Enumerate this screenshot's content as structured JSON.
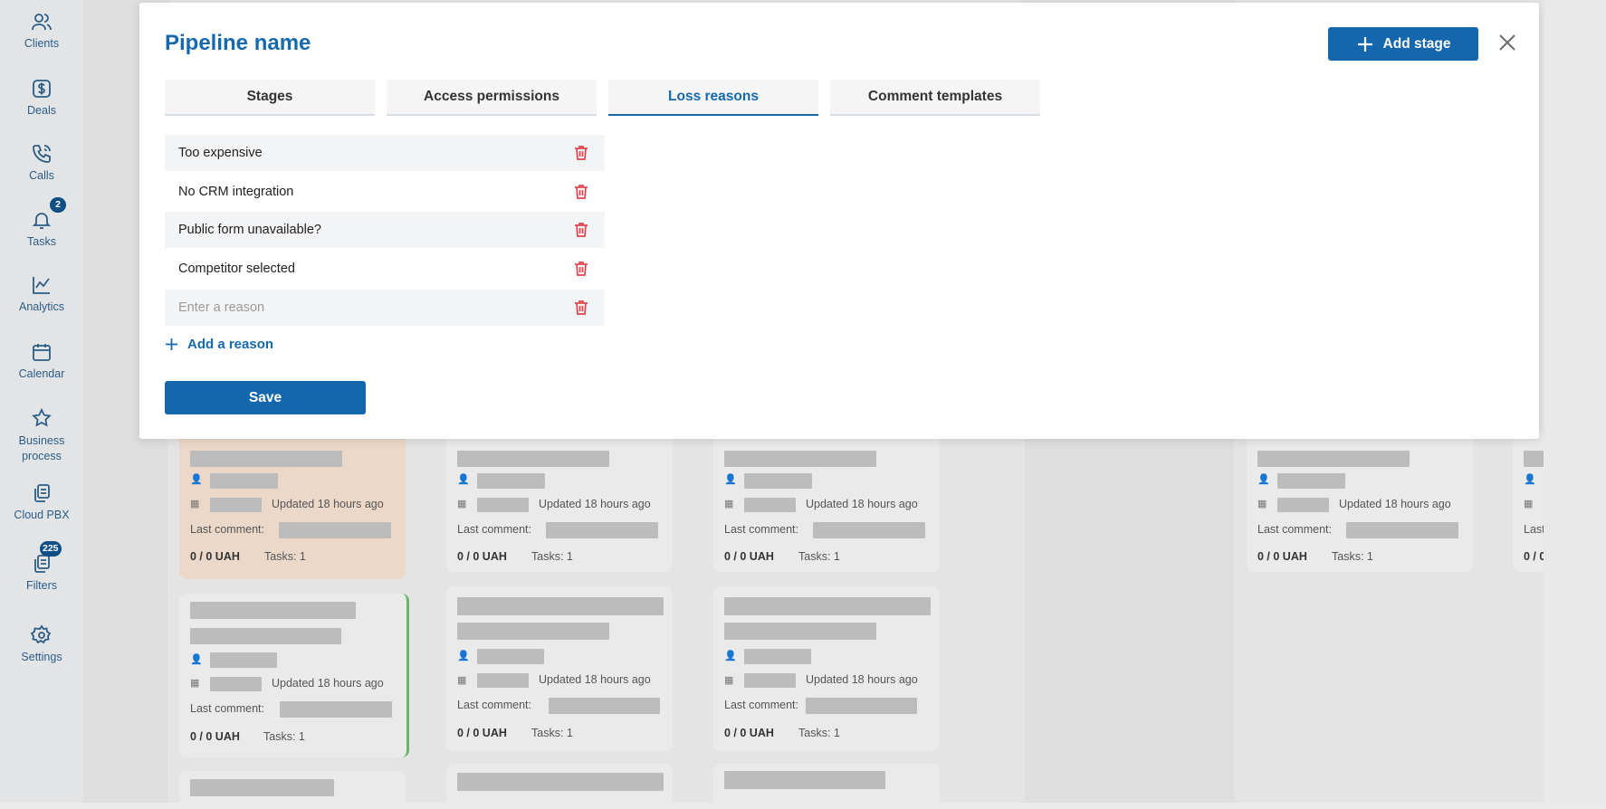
{
  "sidebar": {
    "items": [
      {
        "label": "Clients",
        "icon": "users-icon"
      },
      {
        "label": "Deals",
        "icon": "dollar-icon"
      },
      {
        "label": "Calls",
        "icon": "phone-icon"
      },
      {
        "label": "Tasks",
        "icon": "bell-icon",
        "badge": "2"
      },
      {
        "label": "Analytics",
        "icon": "chart-icon"
      },
      {
        "label": "Calendar",
        "icon": "calendar-icon"
      },
      {
        "label": "Business process",
        "icon": "star-icon"
      },
      {
        "label": "Cloud PBX",
        "icon": "copy-icon"
      },
      {
        "label": "Filters",
        "icon": "filter-icon",
        "badge": "225"
      },
      {
        "label": "Settings",
        "icon": "gear-icon"
      }
    ]
  },
  "board": {
    "updated_text": "Updated 18 hours ago",
    "last_comment_label": "Last comment:",
    "amount_text": "0 / 0 UAH",
    "tasks_text": "Tasks: 1",
    "partial_last_label": "Last",
    "partial_amount": "0 / 0"
  },
  "modal": {
    "title": "Pipeline name",
    "add_stage_label": "Add stage",
    "tabs": [
      {
        "label": "Stages"
      },
      {
        "label": "Access permissions"
      },
      {
        "label": "Loss reasons",
        "active": true
      },
      {
        "label": "Comment templates"
      }
    ],
    "reasons": [
      {
        "value": "Too expensive"
      },
      {
        "value": "No CRM integration"
      },
      {
        "value": "Public form unavailable?"
      },
      {
        "value": "Competitor selected"
      },
      {
        "value": "",
        "placeholder": "Enter a reason"
      }
    ],
    "add_reason_label": "Add a reason",
    "save_label": "Save"
  },
  "colors": {
    "primary": "#1466ad",
    "delete": "#e0434b",
    "badge": "#0f4f86"
  }
}
